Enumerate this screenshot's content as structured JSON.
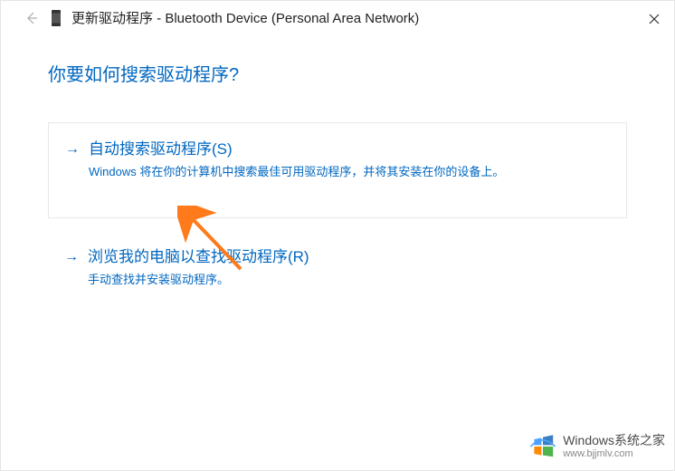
{
  "titlebar": {
    "close_label": "Close"
  },
  "header": {
    "back_label": "Back",
    "title": "更新驱动程序 - Bluetooth Device (Personal Area Network)"
  },
  "content": {
    "heading": "你要如何搜索驱动程序?"
  },
  "options": {
    "auto": {
      "arrow": "→",
      "title": "自动搜索驱动程序(S)",
      "desc": "Windows 将在你的计算机中搜索最佳可用驱动程序，并将其安装在你的设备上。"
    },
    "browse": {
      "arrow": "→",
      "title": "浏览我的电脑以查找驱动程序(R)",
      "desc": "手动查找并安装驱动程序。"
    }
  },
  "watermark": {
    "line1": "Windows系统之家",
    "line2": "www.bjjmlv.com"
  },
  "colors": {
    "accent": "#0067c0"
  }
}
